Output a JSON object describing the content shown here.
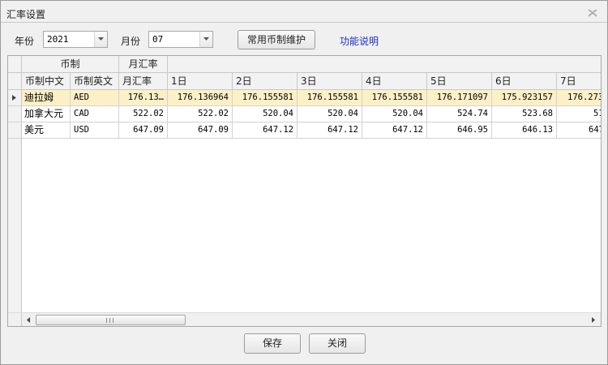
{
  "window": {
    "title": "汇率设置",
    "close_label": "关闭窗口"
  },
  "toolbar": {
    "year_label": "年份",
    "year_value": "2021",
    "month_label": "月份",
    "month_value": "07",
    "maintain_button": "常用币制维护",
    "help_link": "功能说明"
  },
  "grid": {
    "group_headers": {
      "currency": "币制",
      "monthly_rate": "月汇率"
    },
    "columns": {
      "name_cn": "币制中文",
      "name_en": "币制英文",
      "monthly_rate": "月汇率",
      "days": [
        "1日",
        "2日",
        "3日",
        "4日",
        "5日",
        "6日",
        "7日"
      ]
    },
    "rows": [
      {
        "name_cn": "迪拉姆",
        "name_en": "AED",
        "monthly_rate": "176.13…",
        "days": [
          "176.136964",
          "176.155581",
          "176.155581",
          "176.155581",
          "176.171097",
          "175.923157",
          "176.273"
        ],
        "selected": true
      },
      {
        "name_cn": "加拿大元",
        "name_en": "CAD",
        "monthly_rate": "522.02",
        "days": [
          "522.02",
          "520.04",
          "520.04",
          "520.04",
          "524.74",
          "523.68",
          "51"
        ],
        "selected": false
      },
      {
        "name_cn": "美元",
        "name_en": "USD",
        "monthly_rate": "647.09",
        "days": [
          "647.09",
          "647.12",
          "647.12",
          "647.12",
          "646.95",
          "646.13",
          "647"
        ],
        "selected": false
      }
    ],
    "scrollbar_grip": "Ⅲ"
  },
  "footer": {
    "save_button": "保存",
    "close_button": "关闭"
  },
  "colors": {
    "selected_row": "#fdf0c6",
    "link": "#1b2fc4",
    "header_bg": "#f2f2f2"
  },
  "icons": {
    "close": "close-icon",
    "dropdown": "chevron-down-icon",
    "row_indicator": "triangle-right-icon",
    "scroll_left": "arrow-left-icon",
    "scroll_right": "arrow-right-icon"
  }
}
